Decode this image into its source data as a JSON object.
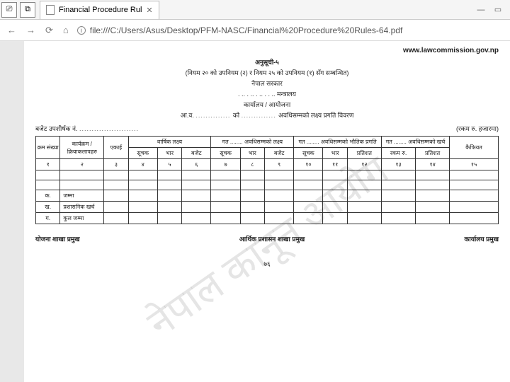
{
  "browser": {
    "tab_title": "Financial Procedure Rul",
    "url": "file:///C:/Users/Asus/Desktop/PFM-NASC/Financial%20Procedure%20Rules-64.pdf",
    "info_glyph": "i"
  },
  "header": {
    "site_url": "www.lawcommission.gov.np",
    "schedule": "अनुसूची-५",
    "rule_ref": "(नियम २० को उपनियम (२) र नियम २५  को उपनियम (१) सँग सम्बन्धित)",
    "gov": "नेपाल सरकार",
    "ministry_line": ". .. . .. . .. . . ..  मन्त्रालय",
    "office_line": "कार्यालय / आयोजना",
    "period_prefix": "आ.व.",
    "period_mid": "को",
    "period_suffix": "अवधिसम्मको लक्ष्य प्रगति विवरण",
    "budget_head": "बजेट उपशीर्षक नं.",
    "unit_note": "(रकम रु. हजारमा)"
  },
  "table": {
    "h1": {
      "c1": "क्रम संख्या",
      "c2": "कार्यक्रम / क्रियाकलापहरु",
      "c3": "एकाई",
      "g1": "वार्षिक लक्ष्य",
      "g2_a": "गत ........",
      "g2_b": "अवधिसम्मको लक्ष्य",
      "g3_a": "गत ........",
      "g3_b": "अवधिसम्मको भौतिक प्रगति",
      "g4_a": "गत ........",
      "g4_b": "अवधिसम्मको खर्च",
      "c15": "कैफियत"
    },
    "h2": {
      "s1": "सूचक",
      "s2": "भार",
      "s3": "बजेट",
      "s4": "सूचक",
      "s5": "भार",
      "s6": "बजेट",
      "s7": "सूचक",
      "s8": "भार",
      "s9": "प्रतिशत",
      "s10": "रकम रु.",
      "s11": "प्रतिशत"
    },
    "nums": [
      "१",
      "२",
      "३",
      "४",
      "५",
      "६",
      "७",
      "८",
      "९",
      "१०",
      "११",
      "१२",
      "१३",
      "१४",
      "१५"
    ],
    "rows": {
      "ka": "क.",
      "ka_label": "जम्मा",
      "kha": "ख.",
      "kha_label": "प्रशासनिक खर्च",
      "ga": "ग.",
      "ga_label": "कुल जम्मा"
    }
  },
  "signatures": {
    "s1": "योजना शाखा प्रमुख",
    "s2": "आर्थिक प्रशासन शाखा प्रमुख",
    "s3": "कार्यालय प्रमुख"
  },
  "watermark": "नेपाल कानून आयोग",
  "page_number": "७६"
}
